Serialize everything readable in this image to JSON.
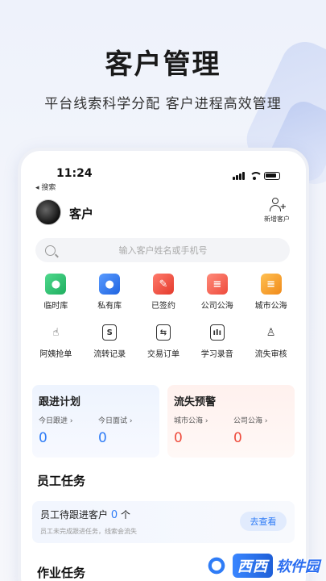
{
  "promo": {
    "title": "客户管理",
    "subtitle": "平台线索科学分配  客户进程高效管理"
  },
  "status_bar": {
    "time": "11:24"
  },
  "back_link": "◂ 搜索",
  "header": {
    "title": "客户",
    "add_label": "新增客户"
  },
  "search": {
    "placeholder": "输入客户姓名或手机号"
  },
  "grid_items": [
    {
      "label": "临时库",
      "icon": "temp-library-icon",
      "color": "#2fbf71"
    },
    {
      "label": "私有库",
      "icon": "private-library-icon",
      "color": "#2f7cf6"
    },
    {
      "label": "已签约",
      "icon": "signed-icon",
      "color": "#ee4b3c"
    },
    {
      "label": "公司公海",
      "icon": "company-pool-icon",
      "color": "#f06b5b"
    },
    {
      "label": "城市公海",
      "icon": "city-pool-icon",
      "color": "#f5a02a"
    },
    {
      "label": "阿姨抢单",
      "icon": "grab-order-icon"
    },
    {
      "label": "流转记录",
      "icon": "transfer-record-icon"
    },
    {
      "label": "交易订单",
      "icon": "trade-order-icon"
    },
    {
      "label": "学习录音",
      "icon": "study-audio-icon"
    },
    {
      "label": "流失审核",
      "icon": "churn-review-icon"
    }
  ],
  "follow_plan": {
    "title": "跟进计划",
    "items": [
      {
        "label": "今日跟进 ›",
        "value": "0"
      },
      {
        "label": "今日面试 ›",
        "value": "0"
      }
    ]
  },
  "churn_alert": {
    "title": "流失预警",
    "items": [
      {
        "label": "城市公海 ›",
        "value": "0"
      },
      {
        "label": "公司公海 ›",
        "value": "0"
      }
    ]
  },
  "staff_tasks": {
    "section_title": "员工任务",
    "task_title": "员工待跟进客户",
    "task_count": "0",
    "task_unit": "个",
    "task_sub": "员工未完成跟进任务，线索会流失",
    "go_label": "去查看"
  },
  "work_tasks": {
    "section_title": "作业任务"
  },
  "watermark": {
    "text1": "西西",
    "text2": "软件园"
  }
}
